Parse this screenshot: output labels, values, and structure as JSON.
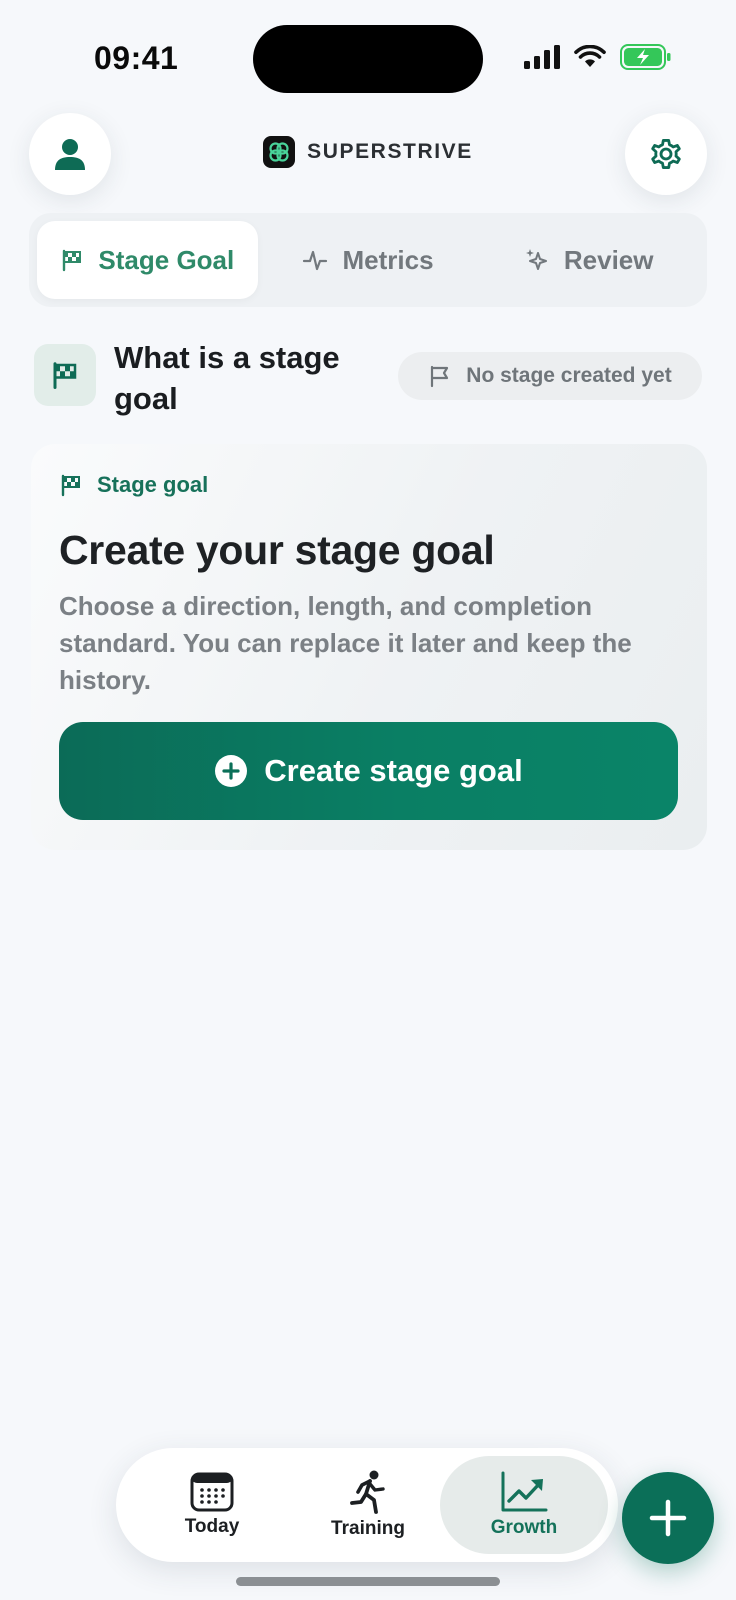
{
  "status_bar": {
    "time": "09:41"
  },
  "header": {
    "brand_name": "SUPERSTRIVE"
  },
  "tabs": [
    {
      "label": "Stage Goal",
      "icon": "flag-checkered-icon",
      "active": true
    },
    {
      "label": "Metrics",
      "icon": "pulse-icon",
      "active": false
    },
    {
      "label": "Review",
      "icon": "sparkle-icon",
      "active": false
    }
  ],
  "info": {
    "title": "What is a stage goal",
    "status_pill": "No stage created yet"
  },
  "card": {
    "tag": "Stage goal",
    "title": "Create your stage goal",
    "description": "Choose a direction, length, and completion standard. You can replace it later and keep the history.",
    "button_label": "Create stage goal"
  },
  "bottom_nav": [
    {
      "label": "Today",
      "icon": "calendar-icon",
      "active": false
    },
    {
      "label": "Training",
      "icon": "running-icon",
      "active": false
    },
    {
      "label": "Growth",
      "icon": "chart-up-icon",
      "active": true
    }
  ],
  "colors": {
    "accent": "#0b6f58",
    "accent_text": "#2f8a69",
    "background": "#f6f8fb"
  }
}
